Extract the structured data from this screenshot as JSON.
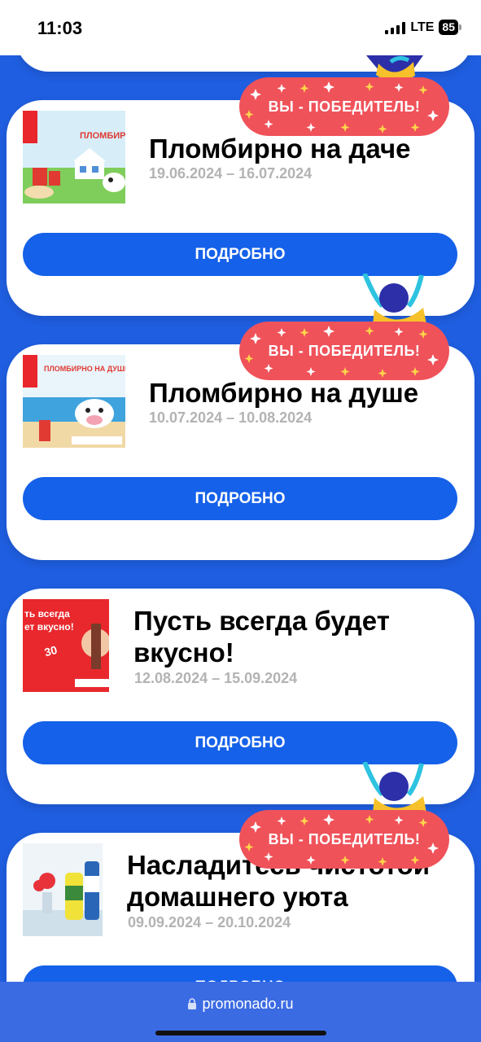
{
  "status_bar": {
    "time": "11:03",
    "network": "LTE",
    "battery": "85"
  },
  "promos": [
    {
      "title": "Пломбирно на даче",
      "dates": "19.06.2024 – 16.07.2024",
      "button_label": "ПОДРОБНО",
      "winner_badge": "ВЫ - ПОБЕДИТЕЛЬ!",
      "thumbnail_text": "ПЛОМБИРНО Н"
    },
    {
      "title": "Пломбирно на душе",
      "dates": "10.07.2024 – 10.08.2024",
      "button_label": "ПОДРОБНО",
      "winner_badge": "ВЫ - ПОБЕДИТЕЛЬ!",
      "thumbnail_text": "ПЛОМБИРНО НА ДУШЕ!"
    },
    {
      "title_line1": "Пусть всегда будет",
      "title_line2": "вкусно!",
      "dates": "12.08.2024 – 15.09.2024",
      "button_label": "ПОДРОБНО",
      "thumbnail_text_1": "ть всегда",
      "thumbnail_text_2": "ет вкусно!"
    },
    {
      "title_line1": "Насладитесь чистотой",
      "title_line2": "домашнего уюта",
      "dates": "09.09.2024 – 20.10.2024",
      "button_label": "ПОДРОБНО",
      "winner_badge": "ВЫ - ПОБЕДИТЕЛЬ!"
    }
  ],
  "browser": {
    "url": "promonado.ru"
  },
  "colors": {
    "page_background": "#1f5ee0",
    "button": "#1561e9",
    "badge": "#f0525a",
    "date_text": "#b3b3b3"
  }
}
